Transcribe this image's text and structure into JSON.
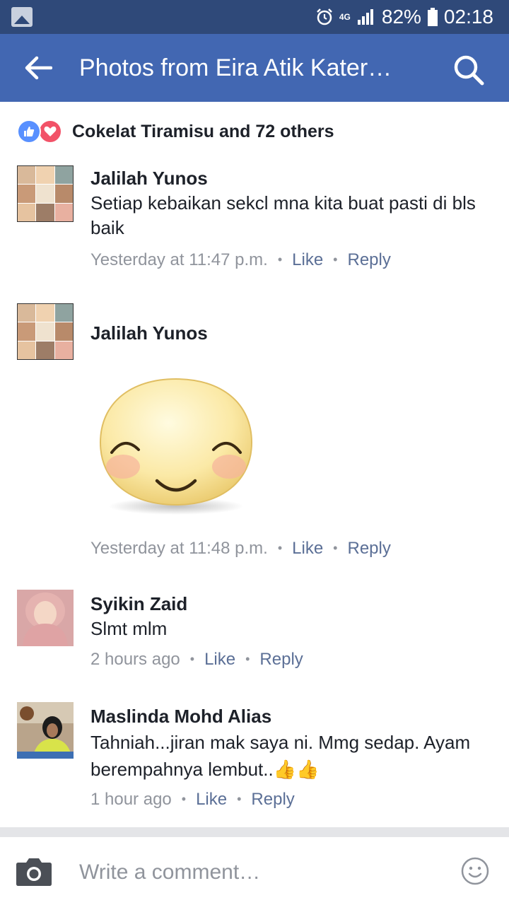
{
  "status_bar": {
    "battery": "82%",
    "time": "02:18",
    "network": "4G"
  },
  "app_bar": {
    "title": "Photos from Eira Atik Kater…",
    "back_icon": "arrow-left-icon",
    "search_icon": "search-icon"
  },
  "reactions": {
    "summary": "Cokelat Tiramisu and 72 others"
  },
  "comments": [
    {
      "name": "Jalilah Yunos",
      "text": "Setiap kebaikan sekcl mna kita buat pasti di bls baik",
      "time": "Yesterday at 11:47 p.m.",
      "like": "Like",
      "reply": "Reply"
    },
    {
      "name": "Jalilah Yunos",
      "text": "",
      "sticker": "smiling-face-sticker",
      "time": "Yesterday at 11:48 p.m.",
      "like": "Like",
      "reply": "Reply"
    },
    {
      "name": "Syikin Zaid",
      "text": "Slmt mlm",
      "time": "2 hours ago",
      "like": "Like",
      "reply": "Reply"
    },
    {
      "name": "Maslinda Mohd Alias",
      "text": "Tahniah...jiran mak saya ni. Mmg sedap. Ayam berempahnya lembut..👍👍",
      "time": "1 hour ago",
      "like": "Like",
      "reply": "Reply"
    }
  ],
  "composer": {
    "placeholder": "Write a comment…"
  },
  "colors": {
    "status_bar": "#2f4979",
    "app_bar": "#4267b2",
    "like_blue": "#5890ff",
    "love_red": "#f25268"
  }
}
